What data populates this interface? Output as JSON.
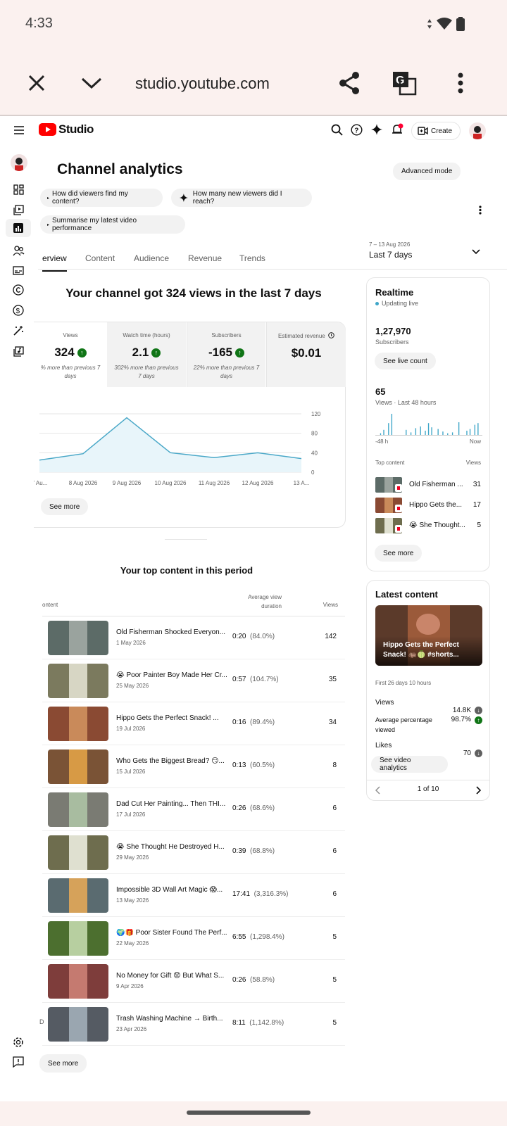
{
  "status": {
    "time": "4:33"
  },
  "browser": {
    "url": "studio.youtube.com"
  },
  "nav": {
    "brand": "Studio",
    "create_label": "Create"
  },
  "page": {
    "title": "Channel analytics",
    "advanced_mode": "Advanced mode"
  },
  "chips": [
    "How did viewers find my content?",
    "How many new viewers did I reach?",
    "Summarise my latest video performance"
  ],
  "tabs": [
    "erview",
    "Content",
    "Audience",
    "Revenue",
    "Trends"
  ],
  "date": {
    "range": "7 – 13 Aug 2026",
    "label": "Last 7 days"
  },
  "overview": {
    "headline": "Your channel got 324 views in the last 7 days",
    "metrics": [
      {
        "label": "Views",
        "value": "324",
        "compare": "% more than previous 7 days"
      },
      {
        "label": "Watch time (hours)",
        "value": "2.1",
        "compare": "302% more than previous 7 days"
      },
      {
        "label": "Subscribers",
        "value": "-165",
        "compare": "22% more than previous 7 days"
      },
      {
        "label": "Estimated revenue",
        "value": "$0.01",
        "compare": ""
      }
    ],
    "see_more": "See more"
  },
  "chart_data": {
    "type": "area",
    "x": [
      "7 Au...",
      "8 Aug 2026",
      "9 Aug 2026",
      "10 Aug 2026",
      "11 Aug 2026",
      "12 Aug 2026",
      "13 A..."
    ],
    "values": [
      25,
      38,
      112,
      40,
      30,
      40,
      28
    ],
    "yticks": [
      "120",
      "80",
      "40",
      "0"
    ],
    "ylim": [
      0,
      120
    ],
    "grid": true,
    "color": "#4aa8c8"
  },
  "top_content": {
    "title": "Your top content in this period",
    "col_content": "ontent",
    "col_avd": "Average view duration",
    "col_views": "Views",
    "rows": [
      {
        "title": "Old Fisherman Shocked Everyon...",
        "date": "1 May 2026",
        "avd": "0:20",
        "pct": "(84.0%)",
        "views": "142",
        "bg": "#5c6b67",
        "fg": "#9aa39e"
      },
      {
        "title": "😭 Poor Painter Boy Made Her Cr...",
        "date": "25 May 2026",
        "avd": "0:57",
        "pct": "(104.7%)",
        "views": "35",
        "bg": "#7b7a5e",
        "fg": "#d7d6c4"
      },
      {
        "title": "Hippo Gets the Perfect Snack! ...",
        "date": "19 Jul 2026",
        "avd": "0:16",
        "pct": "(89.4%)",
        "views": "34",
        "bg": "#8a4a33",
        "fg": "#c98a5a"
      },
      {
        "title": "Who Gets the Biggest Bread? 😏...",
        "date": "15 Jul 2026",
        "avd": "0:13",
        "pct": "(60.5%)",
        "views": "8",
        "bg": "#7a5336",
        "fg": "#d79a45"
      },
      {
        "title": "Dad Cut Her Painting... Then THI...",
        "date": "17 Jul 2026",
        "avd": "0:26",
        "pct": "(68.6%)",
        "views": "6",
        "bg": "#7a7b73",
        "fg": "#a8bca0"
      },
      {
        "title": "😭 She Thought He Destroyed H...",
        "date": "29 May 2026",
        "avd": "0:39",
        "pct": "(68.8%)",
        "views": "6",
        "bg": "#6e6d4e",
        "fg": "#dfe0d0"
      },
      {
        "title": "Impossible 3D Wall Art Magic 😱...",
        "date": "13 May 2026",
        "avd": "17:41",
        "pct": "(3,316.3%)",
        "views": "6",
        "bg": "#5a6b70",
        "fg": "#d6a25a"
      },
      {
        "title": "🌍🎁 Poor Sister Found The Perf...",
        "date": "22 May 2026",
        "avd": "6:55",
        "pct": "(1,298.4%)",
        "views": "5",
        "bg": "#4c6f2f",
        "fg": "#b7cfa0"
      },
      {
        "title": "No Money for Gift 😟 But What S...",
        "date": "9 Apr 2026",
        "avd": "0:26",
        "pct": "(58.8%)",
        "views": "5",
        "bg": "#7e3d3b",
        "fg": "#c57a70"
      },
      {
        "title": "Trash Washing Machine → Birth...",
        "date": "23 Apr 2026",
        "avd": "8:11",
        "pct": "(1,142.8%)",
        "views": "5",
        "bg": "#555b63",
        "fg": "#9aa6b0"
      }
    ],
    "row_prefix": "D",
    "see_more": "See more"
  },
  "realtime": {
    "title": "Realtime",
    "status": "Updating live",
    "subs_value": "1,27,970",
    "subs_label": "Subscribers",
    "see_live": "See live count",
    "views_value": "65",
    "views_label": "Views · Last 48 hours",
    "axis_left": "-48 h",
    "axis_right": "Now",
    "bars": [
      0,
      0,
      0,
      2,
      0,
      6,
      0,
      0,
      14,
      0,
      25,
      0,
      0,
      0,
      0,
      0,
      0,
      0,
      0,
      6,
      0,
      0,
      3,
      0,
      0,
      8,
      0,
      0,
      10,
      0,
      0,
      5,
      0,
      14,
      0,
      9,
      0,
      0,
      0,
      7,
      0,
      0,
      4,
      0,
      0,
      2,
      0,
      0,
      3,
      0,
      0,
      0,
      15,
      0,
      0,
      0,
      0,
      5,
      0,
      7,
      0,
      0,
      12,
      0,
      14,
      0,
      0
    ],
    "top_content_label": "Top content",
    "views_col": "Views",
    "items": [
      {
        "title": "Old Fisherman ...",
        "views": "31"
      },
      {
        "title": "Hippo Gets the...",
        "views": "17"
      },
      {
        "title": "😭 She Thought...",
        "views": "5"
      }
    ],
    "see_more": "See more"
  },
  "latest": {
    "title": "Latest content",
    "video_title": "Hippo Gets the Perfect Snack! 🦛🍈 #shorts...",
    "since": "First 26 days 10 hours",
    "views_label": "Views",
    "views_value": "14.8K",
    "apv_label": "Average percentage viewed",
    "apv_value": "98.7%",
    "likes_label": "Likes",
    "likes_value": "70",
    "button": "See video analytics",
    "pager": "1 of 10"
  },
  "colors": {
    "brand_red": "#ff0000",
    "up_green": "#107516",
    "live_teal": "#3ea6c8"
  }
}
